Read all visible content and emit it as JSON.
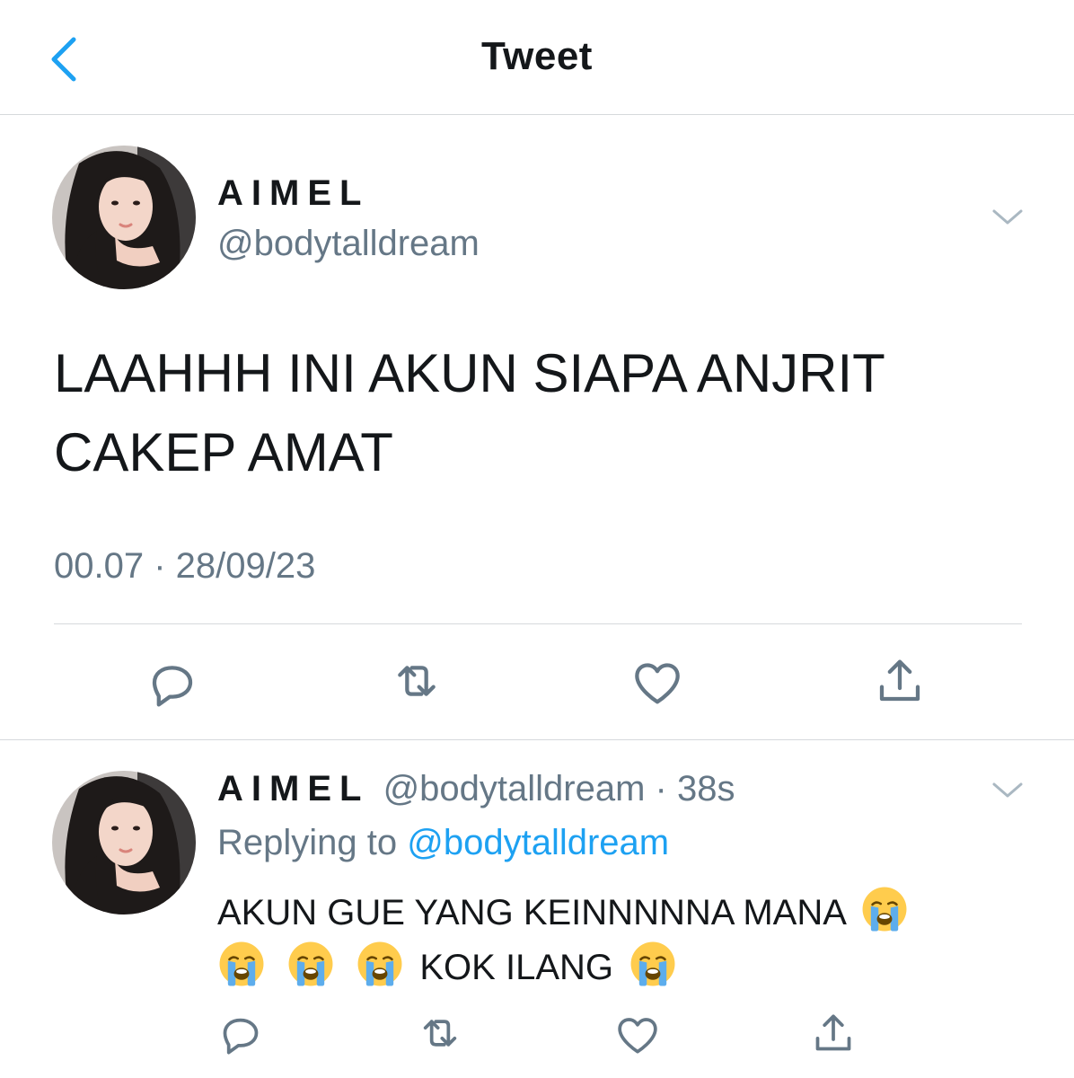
{
  "nav": {
    "title": "Tweet",
    "back_icon": "chevron-left-icon"
  },
  "tweet": {
    "author_name": "AIMEL",
    "author_handle": "@bodytalldream",
    "text_line1": "LAAHHH INI AKUN SIAPA ANJRIT",
    "text_line2": "CAKEP AMAT",
    "timestamp": "00.07 · 28/09/23",
    "actions": [
      "reply-icon",
      "retweet-icon",
      "like-icon",
      "share-icon"
    ]
  },
  "reply": {
    "author_name": "AIMEL",
    "author_handle": "@bodytalldream",
    "separator": "·",
    "age": "38s",
    "replying_prefix": "Replying to",
    "replying_handle": "@bodytalldream",
    "text_part1": "AKUN GUE YANG KEINNNNNA MANA",
    "text_part2": "KOK ILANG",
    "emoji": "loudly-crying-face",
    "actions": [
      "reply-icon",
      "retweet-icon",
      "like-icon",
      "share-icon"
    ]
  },
  "colors": {
    "text": "#14171a",
    "secondary": "#657786",
    "accent": "#1da1f2",
    "divider": "#d6d9dc",
    "icon": "#657786"
  }
}
